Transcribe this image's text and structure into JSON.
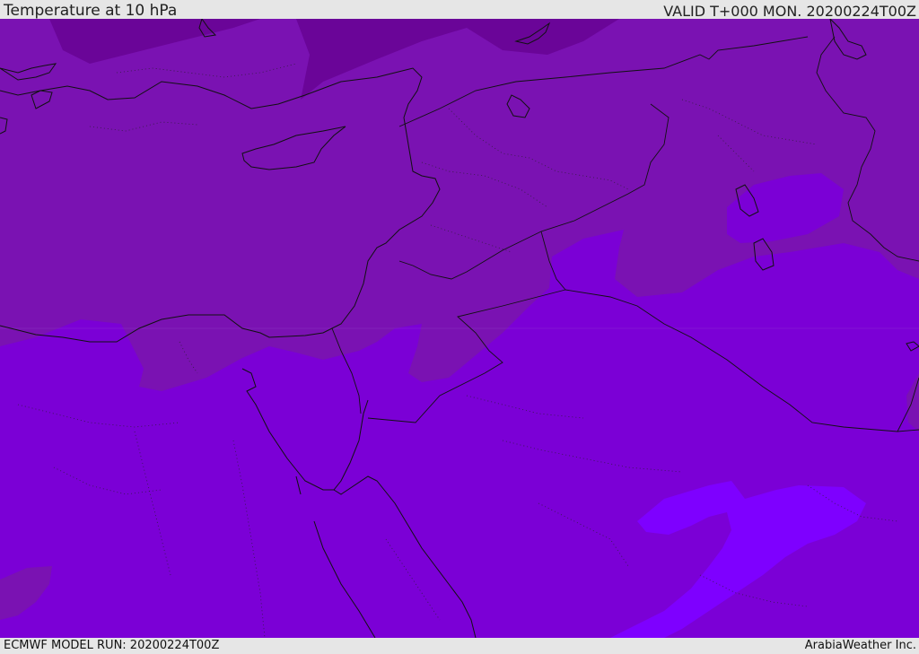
{
  "header": {
    "title": "Temperature at 10 hPa",
    "valid": "VALID T+000 MON. 20200224T00Z"
  },
  "footer": {
    "model_run": "ECMWF MODEL RUN: 20200224T00Z",
    "credit": "ArabiaWeather Inc."
  },
  "colors": {
    "band_coldest": "#6a0598",
    "band_cold": "#7a12b2",
    "band_mid": "#7b00d6",
    "band_warm": "#7e00ff",
    "coastline": "#111111",
    "border": "#111111",
    "bars": "#e6e6e6"
  }
}
